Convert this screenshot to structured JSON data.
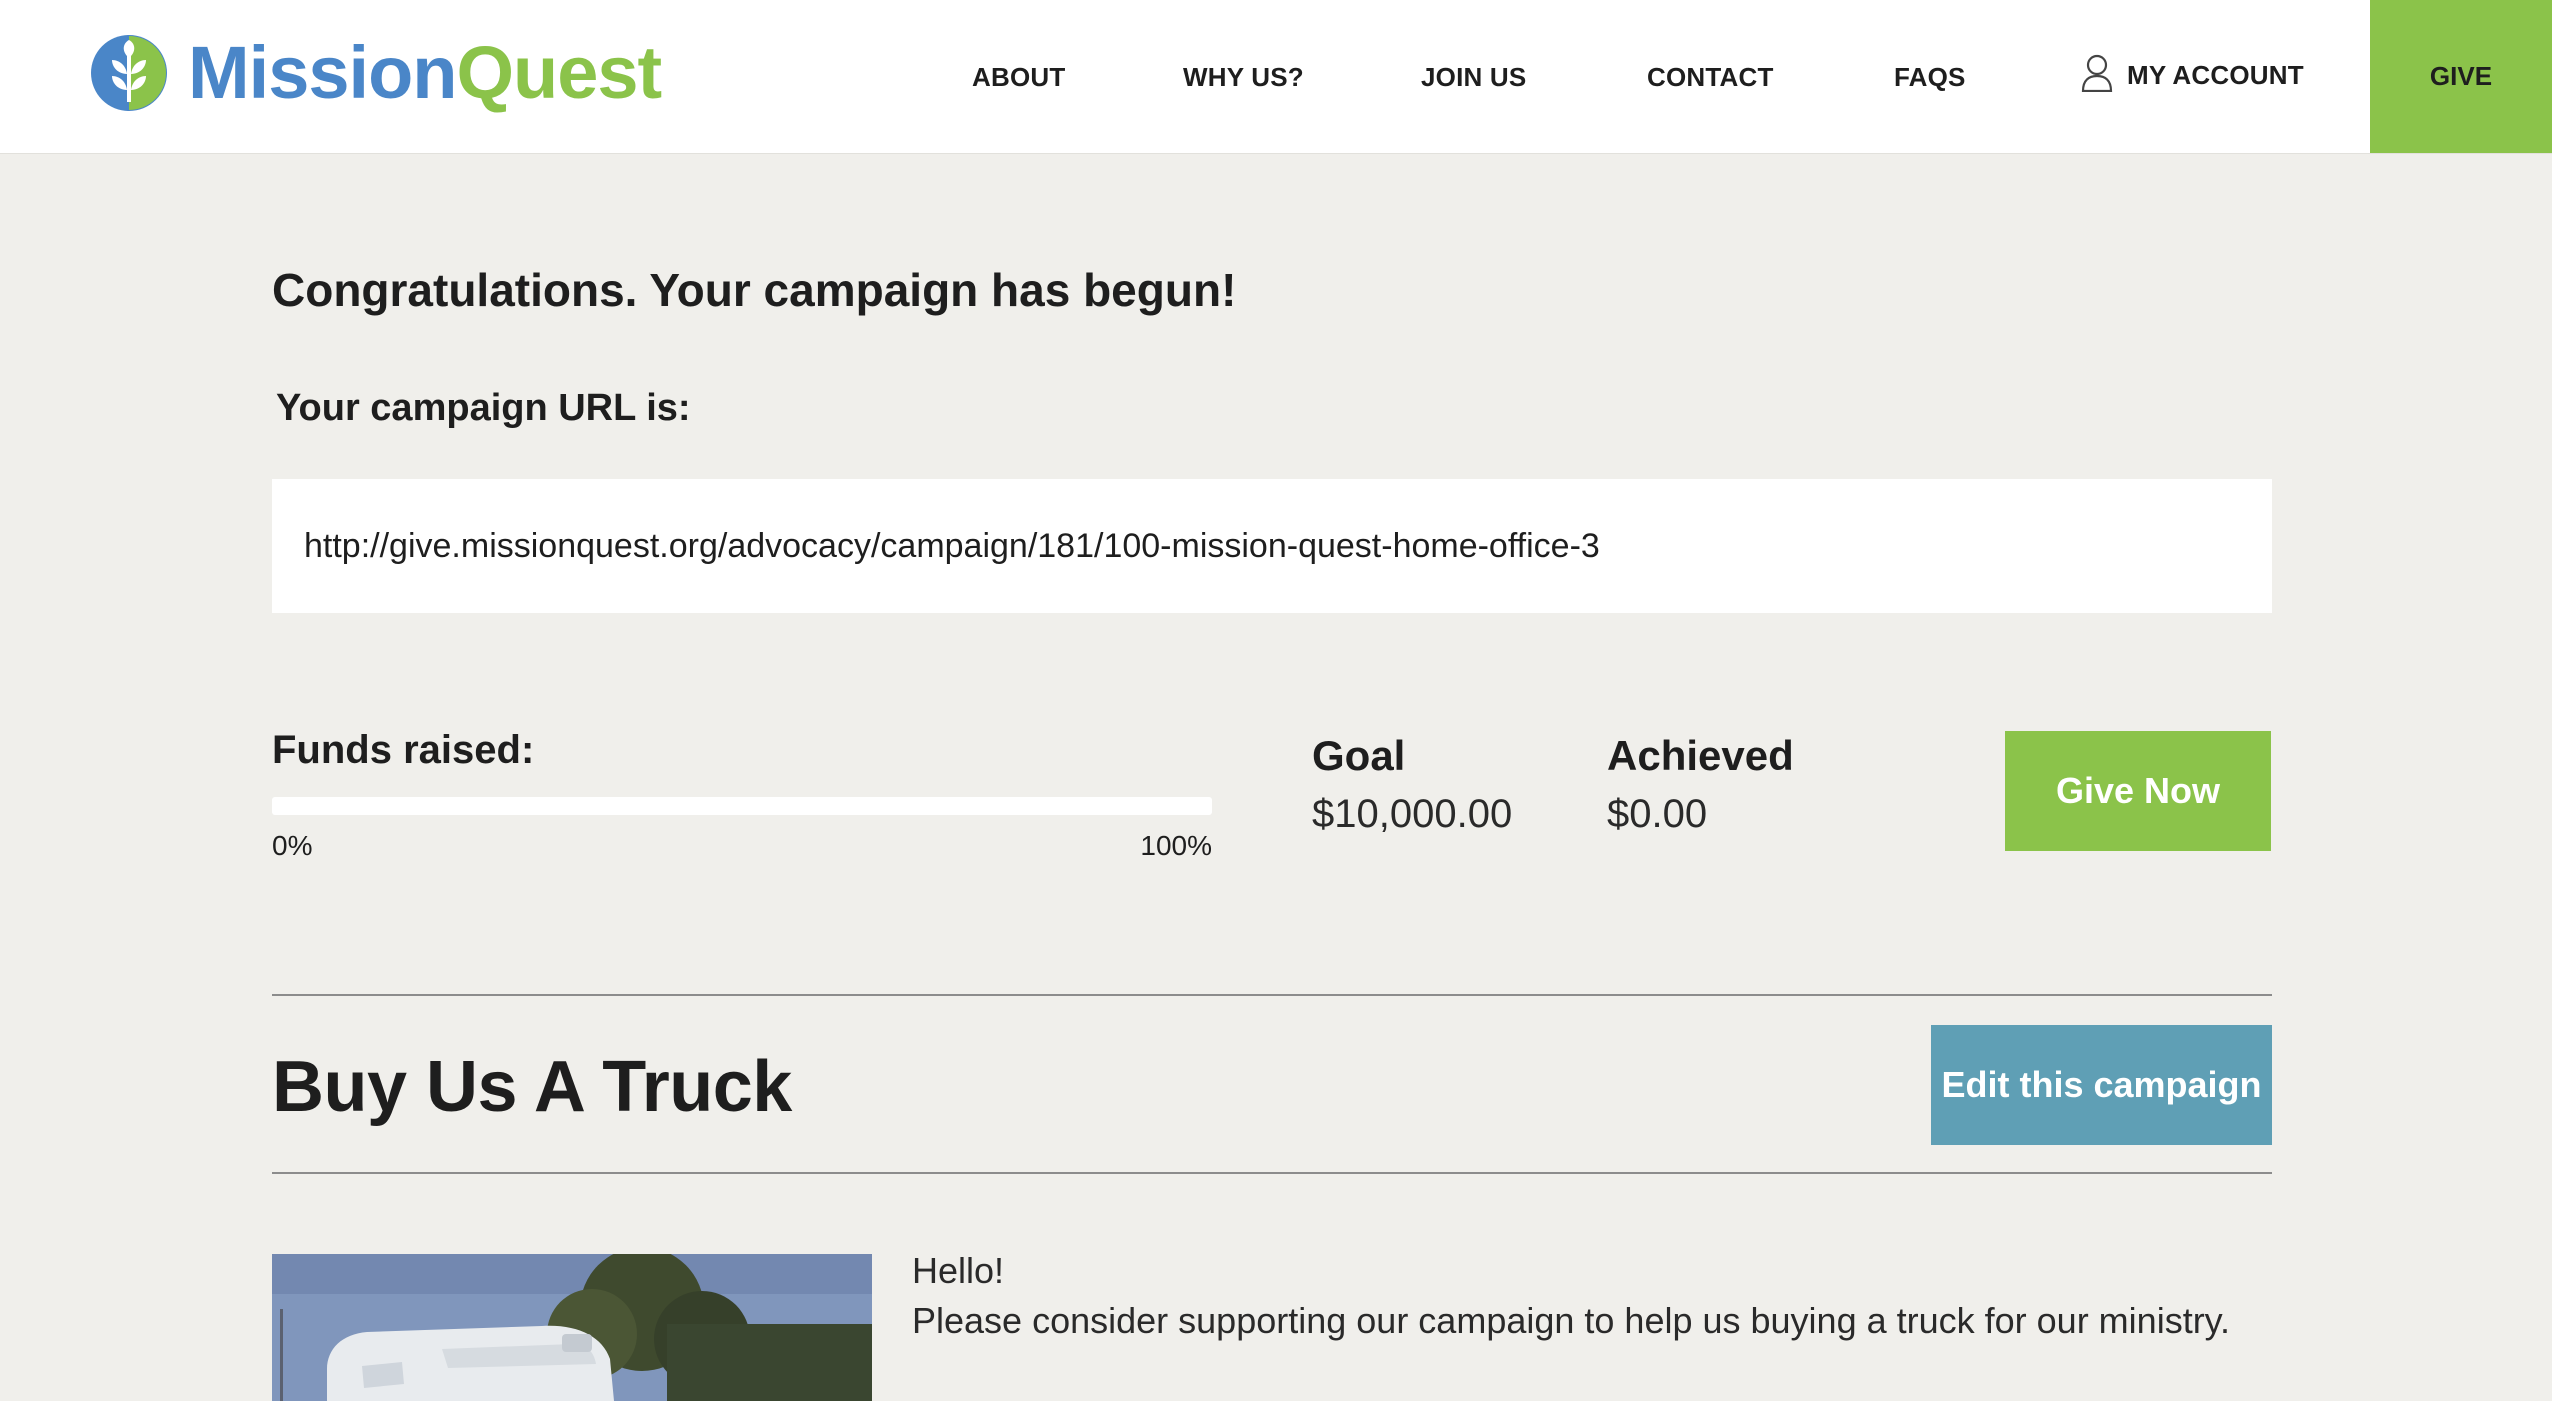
{
  "brand": {
    "part1": "Mission",
    "part2": "Quest",
    "primary_color": "#4a86c8",
    "accent_color": "#8bc34a"
  },
  "nav": {
    "about": "ABOUT",
    "why_us": "WHY US?",
    "join_us": "JOIN US",
    "contact": "CONTACT",
    "faqs": "FAQS",
    "my_account": "MY ACCOUNT",
    "give": "GIVE"
  },
  "main": {
    "headline": "Congratulations. Your campaign has begun!",
    "url_label": "Your campaign URL is:",
    "campaign_url": "http://give.missionquest.org/advocacy/campaign/181/100-mission-quest-home-office-3",
    "funds": {
      "label": "Funds raised:",
      "progress_fraction": 0,
      "min_label": "0%",
      "max_label": "100%"
    },
    "goal": {
      "label": "Goal",
      "value": "$10,000.00"
    },
    "achieved": {
      "label": "Achieved",
      "value": "$0.00"
    },
    "give_now_label": "Give Now",
    "campaign_title": "Buy Us A Truck",
    "edit_label": "Edit this campaign",
    "body_line1": "Hello!",
    "body_line2": "Please consider supporting our campaign to help us buying a truck for our ministry."
  }
}
